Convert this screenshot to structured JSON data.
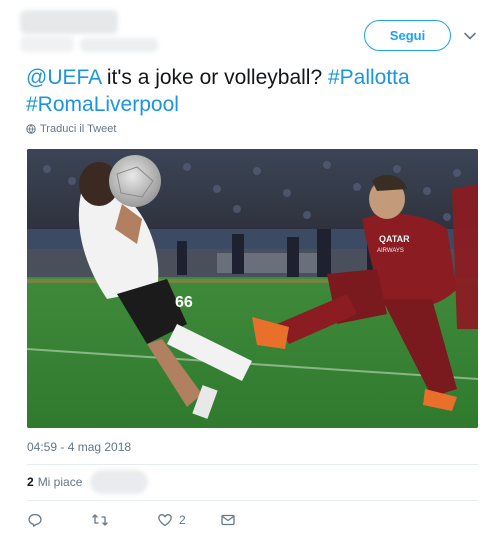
{
  "header": {
    "follow_label": "Segui"
  },
  "tweet": {
    "mention": "@UEFA",
    "text": " it's a joke or volleyball? ",
    "hashtag1": "#Pallotta",
    "hashtag2": "#RomaLiverpool",
    "translate_label": "Traduci il Tweet",
    "timestamp": "04:59 - 4 mag 2018"
  },
  "media": {
    "jersey_text": "QATAR",
    "jersey_text2": "AIRWAYS",
    "shirt_number": "66"
  },
  "stats": {
    "likes_count": "2",
    "likes_label": "Mi piace"
  },
  "actions": {
    "like_count": "2"
  },
  "icons": [
    "chevron-down-icon",
    "globe-icon",
    "reply-icon",
    "retweet-icon",
    "heart-icon",
    "message-icon"
  ],
  "colors": {
    "accent": "#1da1f2",
    "link": "#1b95e0",
    "muted": "#657786"
  }
}
